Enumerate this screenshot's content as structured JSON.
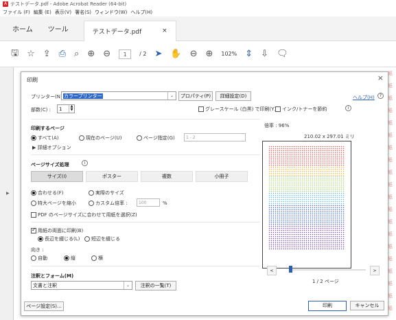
{
  "window": {
    "title": "テストデータ.pdf - Adobe Acrobat Reader (64-bit)"
  },
  "menu": [
    "ファイル (F)",
    "編集 (E)",
    "表示(V)",
    "署名(S)",
    "ウィンドウ(W)",
    "ヘルプ(H)"
  ],
  "tabs": {
    "home": "ホーム",
    "tools": "ツール",
    "doc": "テストデータ.pdf",
    "close": "×"
  },
  "toolbar": {
    "page_current": "1",
    "page_total": "/ 2",
    "zoom": "102%"
  },
  "dialog": {
    "title": "印刷",
    "close": "×",
    "help_link": "ヘルプ(H)",
    "help_q": "?",
    "printer_label": "プリンター(N) :",
    "printer_value": "カラープリンター",
    "properties_button": "プロパティ(P)",
    "advanced_button": "詳細設定(D)",
    "copies_label": "部数(C) :",
    "copies_value": "1",
    "grayscale_label": "グレースケール (白黒) で印刷(Y)",
    "saveink_label": "インク/トナーを節約",
    "pages_title": "印刷するページ",
    "pages_all": "すべて(A)",
    "pages_current": "現在のページ(U)",
    "pages_range": "ページ指定(G)",
    "pages_range_placeholder": "1 - 2",
    "more_options": "▶ 詳細オプション",
    "size_title": "ページサイズ処理",
    "size_buttons": [
      "サイズ(I)",
      "ポスター",
      "複数",
      "小冊子"
    ],
    "fit": "合わせる(F)",
    "actual": "実際のサイズ",
    "shrink": "特大ページを縮小",
    "custom": "カスタム倍率 :",
    "custom_value": "100",
    "custom_unit": "%",
    "paper_by_pdf": "PDF のページサイズに合わせて用紙を選択(Z)",
    "duplex": "用紙の両面に印刷(B)",
    "flip_long": "長辺を綴じる(L)",
    "flip_short": "短辺を綴じる",
    "orientation_label": "向き :",
    "orient_auto": "自動",
    "orient_portrait": "縦",
    "orient_landscape": "横",
    "comments_title": "注釈とフォーム(M)",
    "comments_value": "文書と注釈",
    "comments_list_button": "注釈の一覧(T)",
    "page_setup_button": "ページ設定(S)...",
    "print_button": "印刷",
    "cancel_button": "キャンセル",
    "zoom_label": "倍率 : 96%",
    "paper_size": "210.02 x 297.01 ミリ",
    "page_indicator": "1 / 2 ページ",
    "prev": "<",
    "next": ">"
  },
  "colors": {
    "accent": "#2b5fb5",
    "pdf_red": "#d9242a"
  }
}
